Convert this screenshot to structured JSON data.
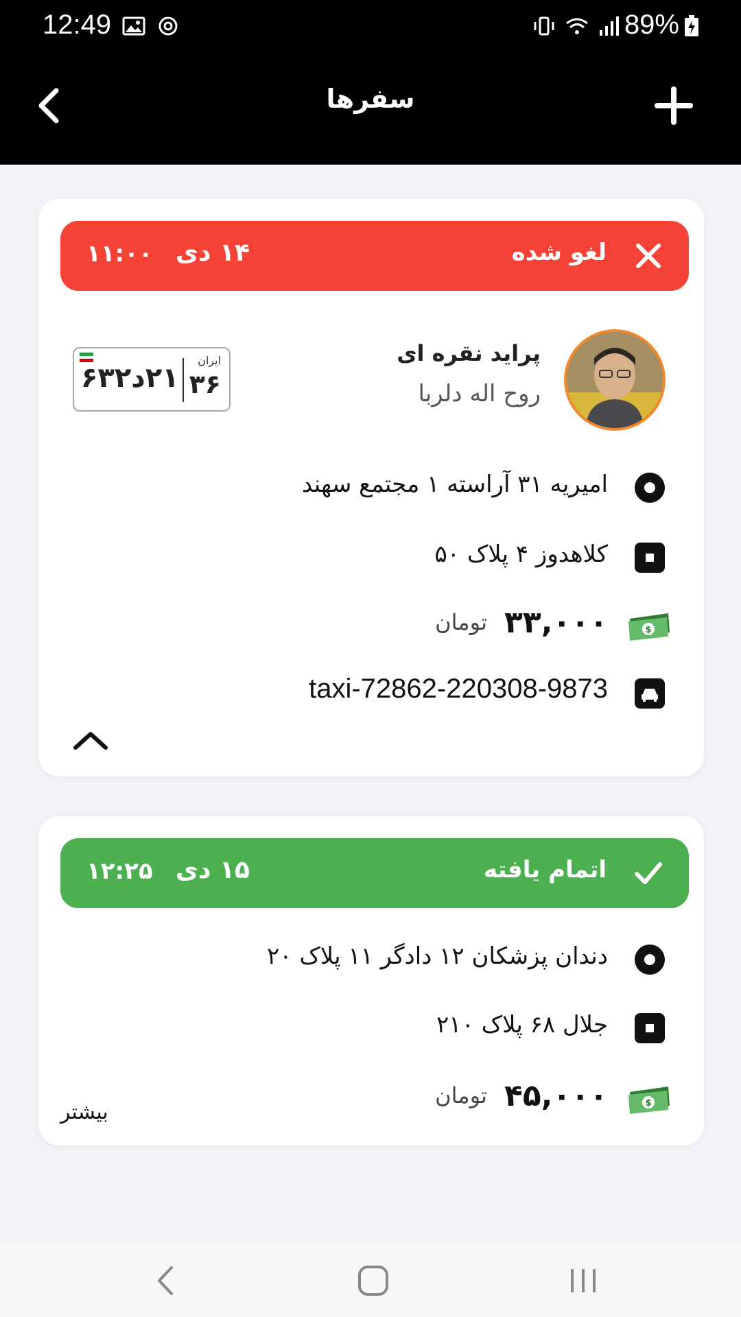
{
  "statusbar": {
    "time": "12:49",
    "battery": "89%"
  },
  "header": {
    "title": "سفرها"
  },
  "trips": [
    {
      "status": "لغو شده",
      "date": "۱۴ دی",
      "time": "۱۱:۰۰",
      "car": "پراید نقره ای",
      "driver": "روح اله دلربا",
      "plate": {
        "country": "ایران",
        "region": "۳۶",
        "number": "۲۱د۶۳۲"
      },
      "origin": "امیریه ۳۱ آراسته ۱ مجتمع سهند",
      "destination": "کلاهدوز ۴ پلاک ۵۰",
      "price": "۳۳,۰۰۰",
      "currency": "تومان",
      "reference": "taxi-72862-220308-9873"
    },
    {
      "status": "اتمام یافته",
      "date": "۱۵ دی",
      "time": "۱۲:۲۵",
      "origin": "دندان پزشکان ۱۲ دادگر ۱۱ پلاک ۲۰",
      "destination": "جلال ۶۸ پلاک ۲۱۰",
      "price": "۴۵,۰۰۰",
      "currency": "تومان",
      "more": "بیشتر"
    }
  ],
  "colors": {
    "cancelled": "#f44336",
    "completed": "#4caf50",
    "avatar_border": "#f08a2c"
  }
}
